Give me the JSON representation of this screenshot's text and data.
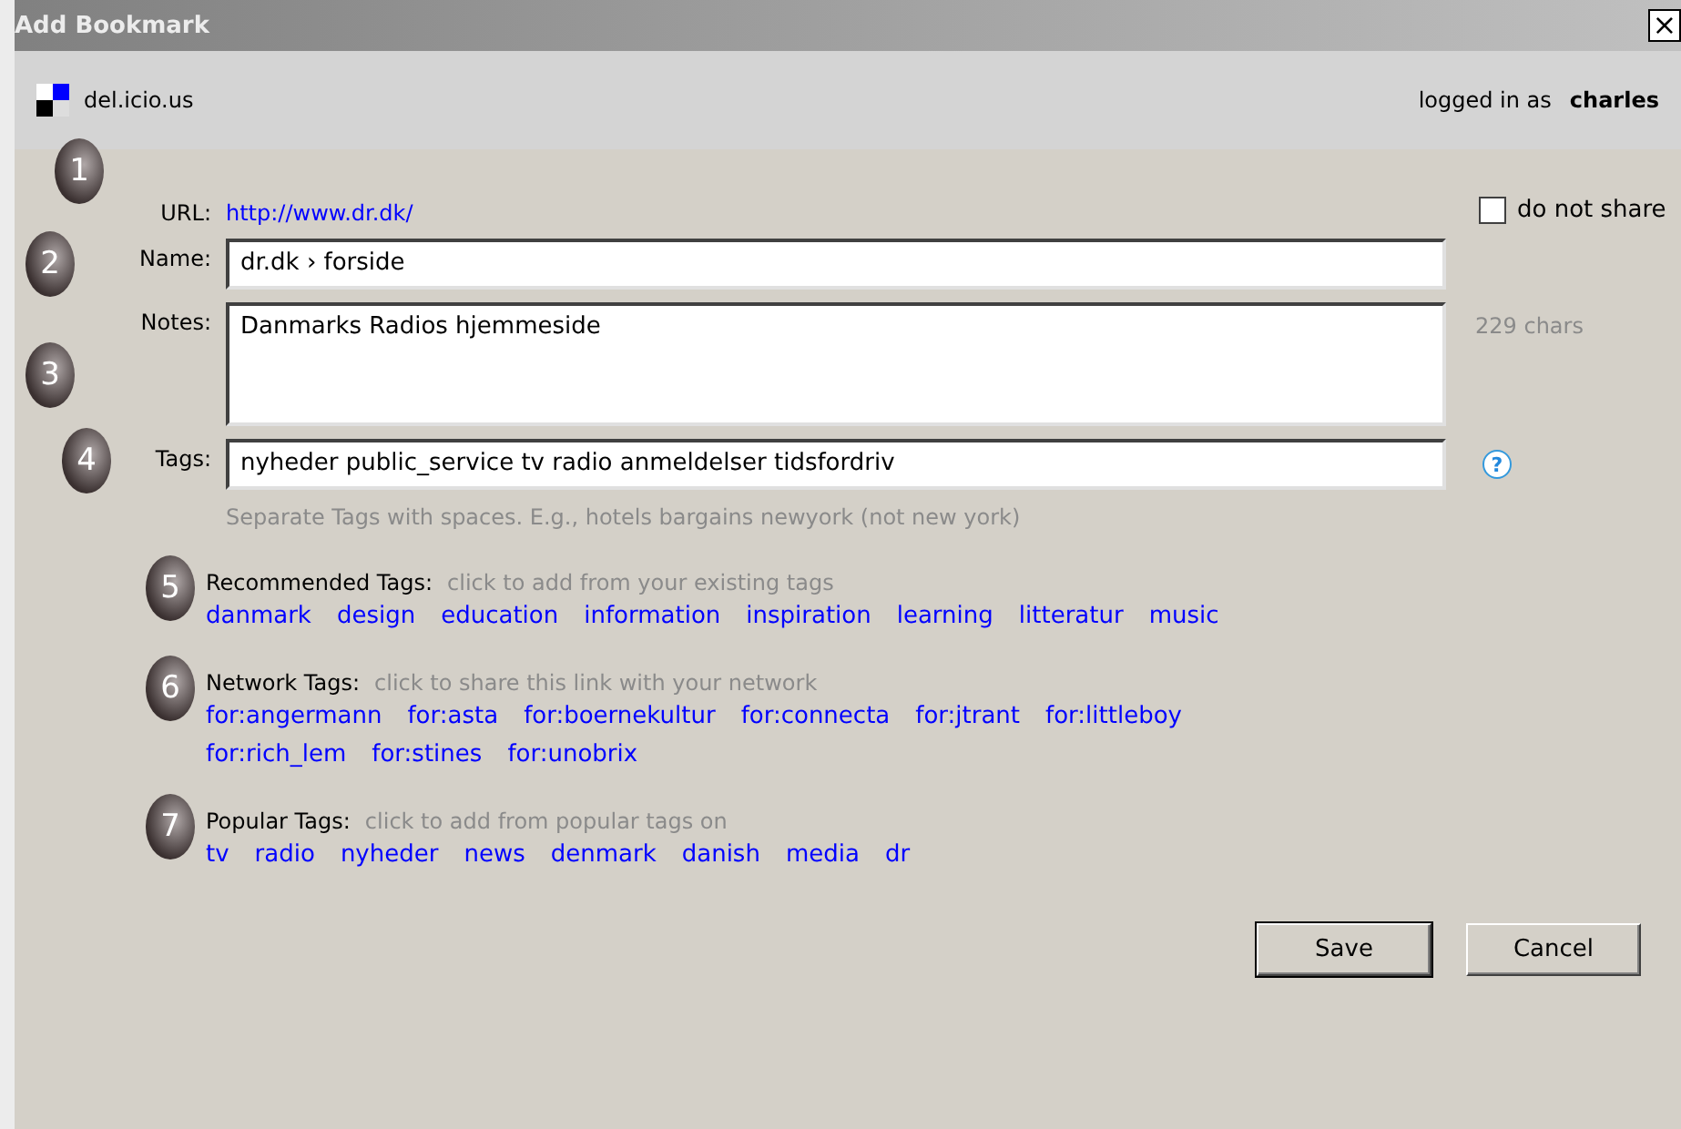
{
  "window": {
    "title": "Add Bookmark",
    "close": "×"
  },
  "header": {
    "site": "del.icio.us",
    "logged_in_label": "logged in as",
    "user": "charles"
  },
  "fields": [
    {
      "step": "1",
      "label": "URL:",
      "kind": "link",
      "value": "http://www.dr.dk/"
    },
    {
      "step": "2",
      "label": "Name:",
      "kind": "input",
      "value": "dr.dk › forside"
    },
    {
      "step": "3",
      "label": "Notes:",
      "kind": "textarea",
      "value": "Danmarks Radios hjemmeside",
      "side": "229 chars"
    },
    {
      "step": "4",
      "label": "Tags:",
      "kind": "input",
      "value": "nyheder public_service tv radio anmeldelser tidsfordriv",
      "help": "?",
      "hint": "Separate Tags with spaces. E.g., hotels bargains newyork (not new york)"
    }
  ],
  "do_not_share": {
    "label": "do not share",
    "checked": false
  },
  "tag_sections": [
    {
      "step": "5",
      "title": "Recommended Tags:",
      "hint": "click to add from your existing tags",
      "tags": [
        "danmark",
        "design",
        "education",
        "information",
        "inspiration",
        "learning",
        "litteratur",
        "music"
      ]
    },
    {
      "step": "6",
      "title": "Network Tags:",
      "hint": "click to share this link with your network",
      "tags": [
        "for:angermann",
        "for:asta",
        "for:boernekultur",
        "for:connecta",
        "for:jtrant",
        "for:littleboy",
        "for:rich_lem",
        "for:stines",
        "for:unobrix"
      ]
    },
    {
      "step": "7",
      "title": "Popular Tags:",
      "hint": "click to add from popular tags on",
      "tags": [
        "tv",
        "radio",
        "nyheder",
        "news",
        "denmark",
        "danish",
        "media",
        "dr"
      ]
    }
  ],
  "buttons": [
    "Save",
    "Cancel"
  ]
}
